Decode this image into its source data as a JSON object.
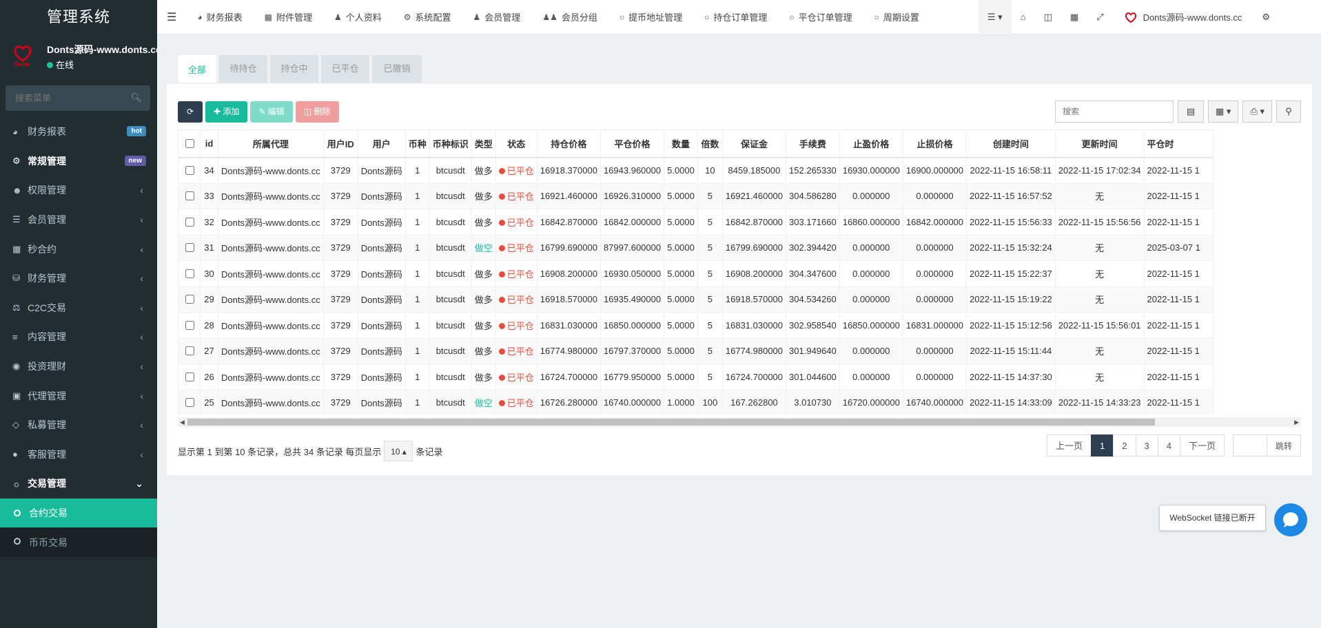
{
  "sidebar": {
    "brand": "管理系统",
    "user": {
      "name": "Donts源码-www.donts.cc",
      "status": "在线"
    },
    "search_placeholder": "搜索菜单",
    "items": [
      {
        "label": "财务报表",
        "icon": "dashboard-icon",
        "badge": "hot"
      },
      {
        "label": "常规管理",
        "icon": "cogs-icon",
        "badge": "new"
      },
      {
        "label": "权限管理",
        "icon": "group-icon"
      },
      {
        "label": "会员管理",
        "icon": "list-icon"
      },
      {
        "label": "秒合约",
        "icon": "calendar-icon"
      },
      {
        "label": "财务管理",
        "icon": "database-icon"
      },
      {
        "label": "C2C交易",
        "icon": "balance-icon"
      },
      {
        "label": "内容管理",
        "icon": "align-icon"
      },
      {
        "label": "投资理财",
        "icon": "compass-icon"
      },
      {
        "label": "代理管理",
        "icon": "briefcase-icon"
      },
      {
        "label": "私募管理",
        "icon": "diamond-icon"
      },
      {
        "label": "客服管理",
        "icon": "comment-icon"
      },
      {
        "label": "交易管理",
        "icon": "eye-icon"
      },
      {
        "label": "合约交易",
        "icon": "circle-icon"
      },
      {
        "label": "币币交易",
        "icon": "circle-icon"
      }
    ]
  },
  "topnav": {
    "items": [
      {
        "label": "财务报表",
        "icon": "dashboard-icon"
      },
      {
        "label": "附件管理",
        "icon": "file-image-icon"
      },
      {
        "label": "个人资料",
        "icon": "user-icon"
      },
      {
        "label": "系统配置",
        "icon": "cog-icon"
      },
      {
        "label": "会员管理",
        "icon": "user-icon"
      },
      {
        "label": "会员分组",
        "icon": "users-icon"
      },
      {
        "label": "提币地址管理",
        "icon": "circle-icon"
      },
      {
        "label": "持仓订单管理",
        "icon": "circle-icon"
      },
      {
        "label": "平仓订单管理",
        "icon": "circle-icon"
      },
      {
        "label": "周期设置",
        "icon": "circle-icon"
      }
    ],
    "site": "Donts源码-www.donts.cc"
  },
  "tabs": [
    "全部",
    "待持仓",
    "持仓中",
    "已平仓",
    "已撤销"
  ],
  "toolbar": {
    "add": "添加",
    "edit": "编辑",
    "delete": "删除",
    "search_placeholder": "搜索"
  },
  "table": {
    "headers": [
      "id",
      "所属代理",
      "用户ID",
      "用户",
      "币种",
      "币种标识",
      "类型",
      "状态",
      "持仓价格",
      "平仓价格",
      "数量",
      "倍数",
      "保证金",
      "手续费",
      "止盈价格",
      "止损价格",
      "创建时间",
      "更新时间",
      "平仓时"
    ],
    "rows": [
      [
        "34",
        "Donts源码-www.donts.cc",
        "3729",
        "Donts源码",
        "1",
        "btcusdt",
        "做多",
        "已平仓",
        "16918.370000",
        "16943.960000",
        "5.0000",
        "10",
        "8459.185000",
        "152.265330",
        "16930.000000",
        "16900.000000",
        "2022-11-15 16:58:11",
        "2022-11-15 17:02:34",
        "2022-11-15 1"
      ],
      [
        "33",
        "Donts源码-www.donts.cc",
        "3729",
        "Donts源码",
        "1",
        "btcusdt",
        "做多",
        "已平仓",
        "16921.460000",
        "16926.310000",
        "5.0000",
        "5",
        "16921.460000",
        "304.586280",
        "0.000000",
        "0.000000",
        "2022-11-15 16:57:52",
        "无",
        "2022-11-15 1"
      ],
      [
        "32",
        "Donts源码-www.donts.cc",
        "3729",
        "Donts源码",
        "1",
        "btcusdt",
        "做多",
        "已平仓",
        "16842.870000",
        "16842.000000",
        "5.0000",
        "5",
        "16842.870000",
        "303.171660",
        "16860.000000",
        "16842.000000",
        "2022-11-15 15:56:33",
        "2022-11-15 15:56:56",
        "2022-11-15 1"
      ],
      [
        "31",
        "Donts源码-www.donts.cc",
        "3729",
        "Donts源码",
        "1",
        "btcusdt",
        "做空",
        "已平仓",
        "16799.690000",
        "87997.600000",
        "5.0000",
        "5",
        "16799.690000",
        "302.394420",
        "0.000000",
        "0.000000",
        "2022-11-15 15:32:24",
        "无",
        "2025-03-07 1"
      ],
      [
        "30",
        "Donts源码-www.donts.cc",
        "3729",
        "Donts源码",
        "1",
        "btcusdt",
        "做多",
        "已平仓",
        "16908.200000",
        "16930.050000",
        "5.0000",
        "5",
        "16908.200000",
        "304.347600",
        "0.000000",
        "0.000000",
        "2022-11-15 15:22:37",
        "无",
        "2022-11-15 1"
      ],
      [
        "29",
        "Donts源码-www.donts.cc",
        "3729",
        "Donts源码",
        "1",
        "btcusdt",
        "做多",
        "已平仓",
        "16918.570000",
        "16935.490000",
        "5.0000",
        "5",
        "16918.570000",
        "304.534260",
        "0.000000",
        "0.000000",
        "2022-11-15 15:19:22",
        "无",
        "2022-11-15 1"
      ],
      [
        "28",
        "Donts源码-www.donts.cc",
        "3729",
        "Donts源码",
        "1",
        "btcusdt",
        "做多",
        "已平仓",
        "16831.030000",
        "16850.000000",
        "5.0000",
        "5",
        "16831.030000",
        "302.958540",
        "16850.000000",
        "16831.000000",
        "2022-11-15 15:12:56",
        "2022-11-15 15:56:01",
        "2022-11-15 1"
      ],
      [
        "27",
        "Donts源码-www.donts.cc",
        "3729",
        "Donts源码",
        "1",
        "btcusdt",
        "做多",
        "已平仓",
        "16774.980000",
        "16797.370000",
        "5.0000",
        "5",
        "16774.980000",
        "301.949640",
        "0.000000",
        "0.000000",
        "2022-11-15 15:11:44",
        "无",
        "2022-11-15 1"
      ],
      [
        "26",
        "Donts源码-www.donts.cc",
        "3729",
        "Donts源码",
        "1",
        "btcusdt",
        "做多",
        "已平仓",
        "16724.700000",
        "16779.950000",
        "5.0000",
        "5",
        "16724.700000",
        "301.044600",
        "0.000000",
        "0.000000",
        "2022-11-15 14:37:30",
        "无",
        "2022-11-15 1"
      ],
      [
        "25",
        "Donts源码-www.donts.cc",
        "3729",
        "Donts源码",
        "1",
        "btcusdt",
        "做空",
        "已平仓",
        "16726.280000",
        "16740.000000",
        "1.0000",
        "100",
        "167.262800",
        "3.010730",
        "16720.000000",
        "16740.000000",
        "2022-11-15 14:33:09",
        "2022-11-15 14:33:23",
        "2022-11-15 1"
      ]
    ]
  },
  "pagination": {
    "info_prefix": "显示第 1 到第 10 条记录，总共 34 条记录 每页显示",
    "page_size": "10",
    "info_suffix": "条记录",
    "prev": "上一页",
    "pages": [
      "1",
      "2",
      "3",
      "4"
    ],
    "next": "下一页",
    "go": "跳转"
  },
  "websocket": {
    "status": "WebSocket 链接已断开"
  },
  "colors": {
    "sidebar_bg": "#222d32",
    "accent": "#18bc9c",
    "dark_btn": "#2c3e50",
    "status_red": "#e74c3c"
  }
}
